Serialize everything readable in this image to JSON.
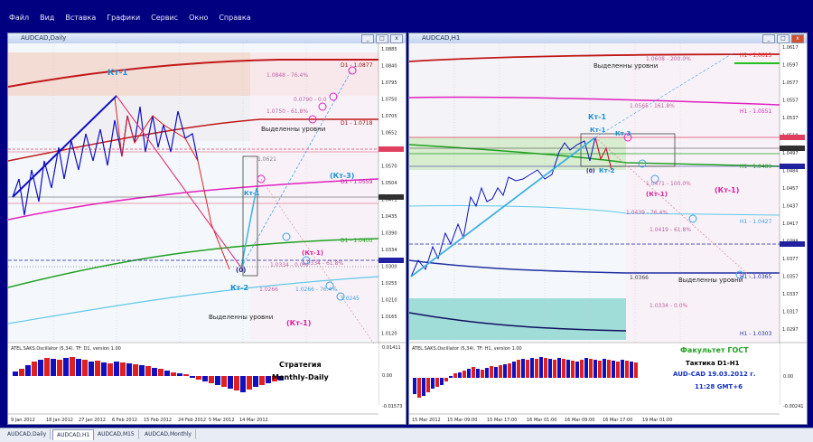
{
  "menu": [
    "Файл",
    "Вид",
    "Вставка",
    "Графики",
    "Сервис",
    "Окно",
    "Справка"
  ],
  "left_window": {
    "title": "AUDCAD,Daily",
    "indicator_label": "ATEL.SAKS.Oscillator (5,34). TF: D1, version 1.00",
    "strategy_line1": "Стратегия",
    "strategy_line2": "Monthly-Daily",
    "kt1_label": "Кт-1",
    "kt2_label": "Кт-2",
    "kt3_label": "(Кт-3)",
    "kt1_small": "Кт-1",
    "kt1_pink": "(Кт-1)",
    "kt1_pink2": "(Кт-1)",
    "zero_label": "(0)",
    "level_label1": "Выделенны уровни",
    "level_label2": "Выделенны уровни",
    "levels": [
      "1.0848 - 76.4%",
      "D1 - 1.0877",
      "1.0750 - 61.8%",
      "D1 - 1.0718",
      "0.0790 - 0.0",
      "1.0621",
      "D1 - 1.0559",
      "D1 - 1.0400",
      "1.0334 - 0.0%",
      "1.0334 - 61.8%",
      "1.0266",
      "1.0266 - 76.4%",
      "1.0245"
    ],
    "price_axis": [
      "1.0885",
      "1.0840",
      "1.0795",
      "1.0750",
      "1.0705",
      "1.0652",
      "1.0615",
      "1.0570",
      "1.0504",
      "1.0471",
      "1.0435",
      "1.0390",
      "1.0334",
      "1.0300",
      "1.0255",
      "1.0210",
      "1.0165",
      "1.0120"
    ],
    "osc_axis": [
      "0.01411",
      "0.00",
      "-0.01573"
    ],
    "time_axis": [
      "9 Jan 2012",
      "18 Jan 2012",
      "27 Jan 2012",
      "6 Feb 2012",
      "15 Feb 2012",
      "24 Feb 2012",
      "5 Mar 2012",
      "14 Mar 2012"
    ]
  },
  "right_window": {
    "title": "AUDCAD,H1",
    "indicator_label": "ATEL.SAKS.Oscillator (5,34). TF: H1, version 1.00",
    "info_title": "Факультет ГОСТ",
    "info_tactic": "Тактика D1-H1",
    "info_pair": "AUD-CAD 19.03.2012 г.",
    "info_time": "11:28   GMT+6",
    "kt1_label": "Кт-1",
    "kt1_small": "Кт-1",
    "kt2_label": "Кт-2",
    "kt3_label": "Кт-3",
    "kt1_pink": "(Кт-1)",
    "kt1_pink2": "(Кт-1)",
    "zero_label": "(0)",
    "level_label1": "Выделенны уровни",
    "level_label2": "Выделенны уровни",
    "levels": [
      "1.0608 - 200.0%",
      "H1 - 1.0613",
      "1.0565 - 161.8%",
      "H1 - 1.0551",
      "H1 - 1.0489",
      "1.0471 - 100.0%",
      "1.0439 - 76.4%",
      "1.0419 - 61.8%",
      "H1 - 1.0427",
      "1.0366",
      "H1 - 1.0365",
      "1.0334 - 0.0%",
      "H1 - 1.0303"
    ],
    "price_axis": [
      "1.0617",
      "1.0597",
      "1.0577",
      "1.0557",
      "1.0537",
      "1.0518",
      "1.0497",
      "1.0484",
      "1.0457",
      "1.0437",
      "1.0417",
      "1.0398",
      "1.0377",
      "1.0357",
      "1.0337",
      "1.0317",
      "1.0297"
    ],
    "osc_axis": [
      "0.00",
      "-0.00241"
    ],
    "time_axis": [
      "15 Mar 2012",
      "15 Mar 09:00",
      "15 Mar 17:00",
      "16 Mar 01:00",
      "16 Mar 09:00",
      "16 Mar 17:00",
      "19 Mar 01:00"
    ]
  },
  "tabs": [
    "AUDCAD,Daily",
    "AUDCAD,H1",
    "AUDCAD,M15",
    "AUDCAD,Monthly"
  ],
  "colors": {
    "up": "#1010c0",
    "down": "#e02020",
    "pink": "#e04080",
    "cyan": "#40b0e0",
    "green": "#20a020",
    "maroon": "#a01010"
  }
}
